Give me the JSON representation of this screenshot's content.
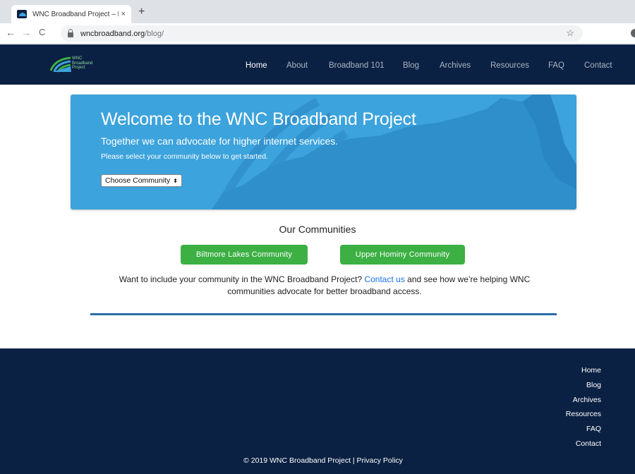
{
  "browser": {
    "tab_title": "WNC Broadband Project – Brid",
    "tab_close": "×",
    "new_tab": "+",
    "back": "←",
    "forward": "→",
    "reload": "C",
    "url_host": "wncbroadband.org",
    "url_path": "/blog/",
    "bookmark": "☆"
  },
  "header": {
    "logo_lines": [
      "WNC",
      "Broadband",
      "Project"
    ],
    "nav": [
      {
        "label": "Home",
        "active": true
      },
      {
        "label": "About"
      },
      {
        "label": "Broadband 101"
      },
      {
        "label": "Blog"
      },
      {
        "label": "Archives"
      },
      {
        "label": "Resources"
      },
      {
        "label": "FAQ"
      },
      {
        "label": "Contact"
      }
    ]
  },
  "hero": {
    "title": "Welcome to the WNC Broadband Project",
    "subtitle": "Together we can advocate for higher internet services.",
    "note": "Please select your community below to get started.",
    "select_value": "Choose Community",
    "select_arrows": "⬍"
  },
  "communities": {
    "title": "Our Communities",
    "buttons": [
      "Biltmore Lakes Community",
      "Upper Hominy Community"
    ],
    "invite_before": "Want to include your community in the WNC Broadband Project? ",
    "invite_link": "Contact us",
    "invite_after": " and see how we’re helping WNC communities advocate for better broadband access."
  },
  "footer": {
    "links": [
      "Home",
      "Blog",
      "Archives",
      "Resources",
      "FAQ",
      "Contact"
    ],
    "copyright": "© 2019 WNC Broadband Project | Privacy Policy"
  },
  "colors": {
    "navy": "#0b2143",
    "hero_blue": "#3ca3dc",
    "green": "#3cb043",
    "link": "#1a73e8",
    "divider": "#2d6aa8"
  }
}
